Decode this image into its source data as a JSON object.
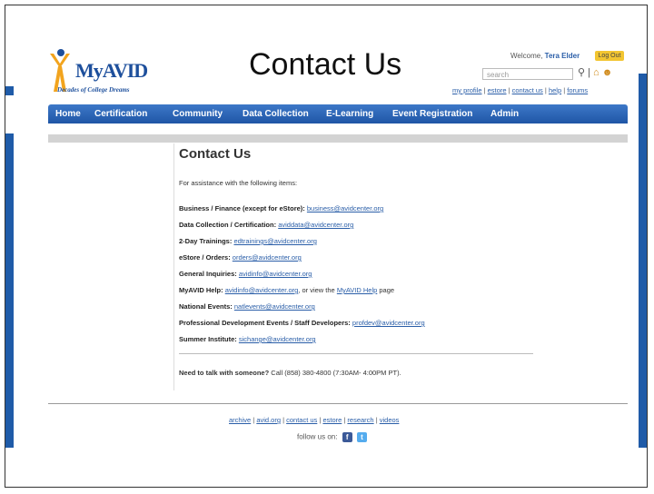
{
  "slide_title": "Contact Us",
  "logo": {
    "text": "MyAVID",
    "tagline": "Decades of College Dreams"
  },
  "header": {
    "welcome_prefix": "Welcome,",
    "user_name": "Tera Elder",
    "logout_label": "Log Out",
    "search_placeholder": "search",
    "links": [
      "my profile",
      "estore",
      "contact us",
      "help",
      "forums"
    ]
  },
  "nav": [
    "Home",
    "Certification",
    "Community",
    "Data Collection",
    "E-Learning",
    "Event Registration",
    "Admin"
  ],
  "page": {
    "heading": "Contact Us",
    "intro": "For assistance with the following items:",
    "contacts": [
      {
        "label": "Business / Finance (except for eStore):",
        "email": "business@avidcenter.org"
      },
      {
        "label": "Data Collection / Certification:",
        "email": "aviddata@avidcenter.org"
      },
      {
        "label": "2-Day Trainings:",
        "email": "edtrainings@avidcenter.org"
      },
      {
        "label": "eStore / Orders:",
        "email": "orders@avidcenter.org"
      },
      {
        "label": "General Inquiries:",
        "email": "avidinfo@avidcenter.org"
      },
      {
        "label": "MyAVID Help:",
        "email": "avidinfo@avidcenter.org",
        "suffix_pre": ", or view the",
        "suffix_link": "MyAVID Help",
        "suffix_post": "page"
      },
      {
        "label": "National Events:",
        "email": "natlevents@avidcenter.org"
      },
      {
        "label": "Professional Development Events / Staff Developers:",
        "email": "profdev@avidcenter.org"
      },
      {
        "label": "Summer Institute:",
        "email": "sichange@avidcenter.org"
      }
    ],
    "talk_label": "Need to talk with someone?",
    "talk_text": "Call (858) 380-4800 (7:30AM- 4:00PM PT)."
  },
  "footer": {
    "links": [
      "archive",
      "avid.org",
      "contact us",
      "estore",
      "research",
      "videos"
    ],
    "follow_label": "follow us on:",
    "social": [
      "facebook-icon",
      "twitter-icon"
    ]
  },
  "colors": {
    "nav_blue": "#1f56a6",
    "link_blue": "#2a5ea8",
    "logo_orange": "#f2a41e",
    "logout_yellow": "#f2c531"
  }
}
